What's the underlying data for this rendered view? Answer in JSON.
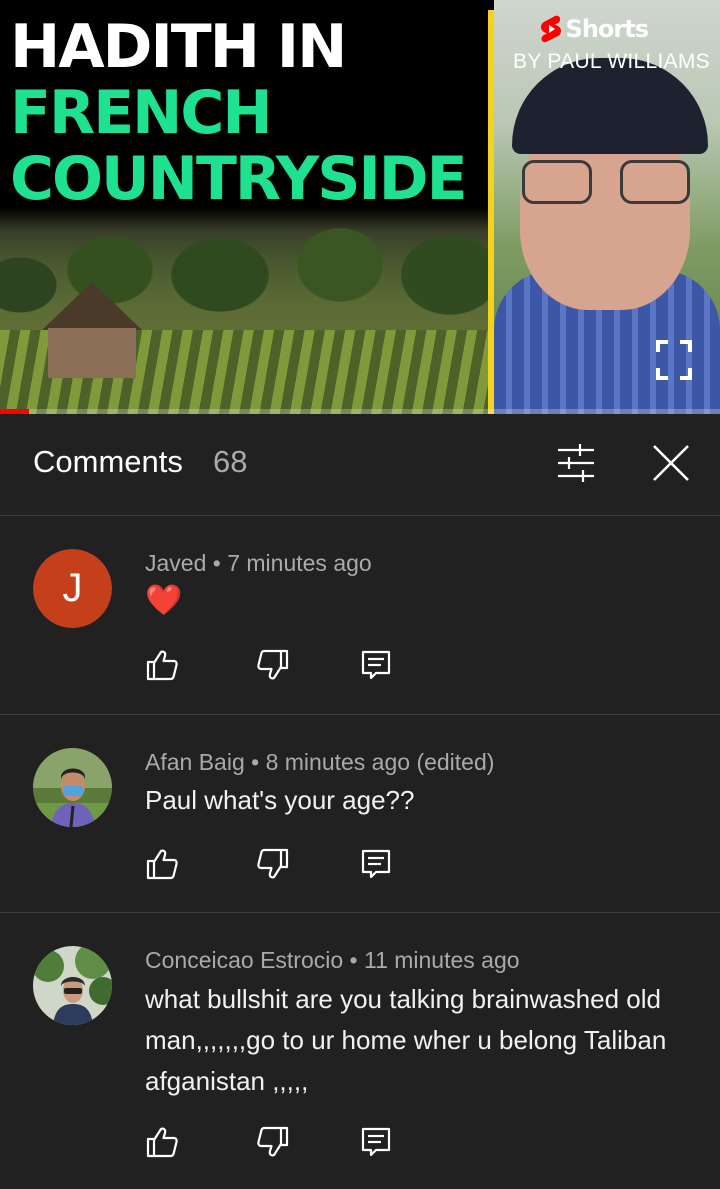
{
  "video": {
    "title_lines": [
      "HADITH IN",
      "FRENCH",
      "COUNTRYSIDE"
    ],
    "shorts_label": "Shorts",
    "byline": "BY PAUL WILLIAMS",
    "progress_percent": 4,
    "colors": {
      "title_green": "#1ee28f",
      "accent_yellow": "#f5d21e",
      "progress_red": "#ff0000"
    }
  },
  "comments_panel": {
    "title": "Comments",
    "count": "68",
    "filter_icon": "sliders-icon",
    "close_icon": "close-icon"
  },
  "comments": [
    {
      "author": "Javed",
      "meta": "Javed • 7 minutes ago",
      "avatar_letter": "J",
      "text": "❤️"
    },
    {
      "author": "Afan Baig",
      "meta": "Afan Baig • 8 minutes ago (edited)",
      "text": "Paul what's your age??"
    },
    {
      "author": "Conceicao Estrocio",
      "meta": "Conceicao Estrocio • 11 minutes ago",
      "text": "what bullshit are you talking brainwashed old man,,,,,,,go to ur home wher u belong Taliban afganistan ,,,,,"
    }
  ],
  "comment_actions": {
    "like_icon": "thumbs-up-icon",
    "dislike_icon": "thumbs-down-icon",
    "reply_icon": "reply-icon"
  }
}
